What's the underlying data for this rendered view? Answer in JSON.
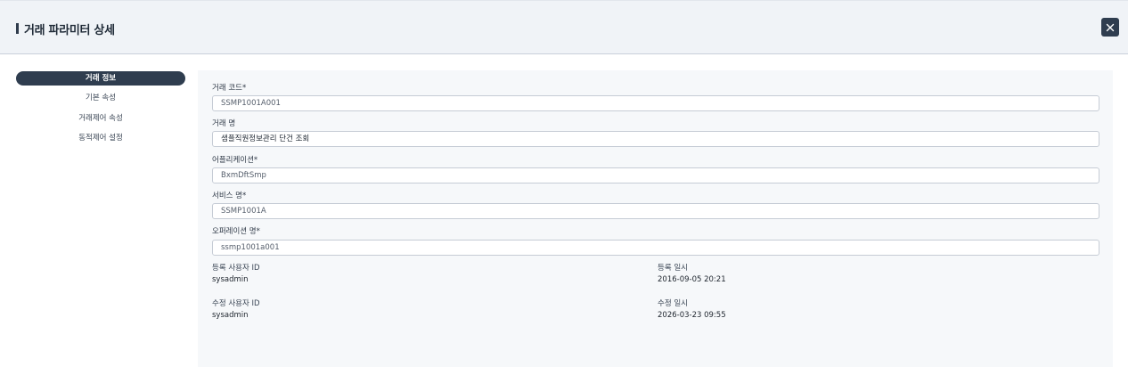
{
  "header": {
    "title": "거래 파라미터 상세",
    "close_icon": "close-icon"
  },
  "sidebar": {
    "items": [
      {
        "label": "거래 정보",
        "active": true
      },
      {
        "label": "기본 속성",
        "active": false
      },
      {
        "label": "거래제어 속성",
        "active": false
      },
      {
        "label": "동적제어 설정",
        "active": false
      }
    ]
  },
  "form": {
    "fields": [
      {
        "label": "거래 코드*",
        "value": "SSMP1001A001"
      },
      {
        "label": "거래 명",
        "value": "샘플직원정보관리 단건 조회"
      },
      {
        "label": "어플리케이션*",
        "value": "BxmDftSmp"
      },
      {
        "label": "서비스 명*",
        "value": "SSMP1001A"
      },
      {
        "label": "오퍼레이션 명*",
        "value": "ssmp1001a001"
      }
    ],
    "meta": {
      "reg_user_label": "등록 사용자 ID",
      "reg_user_value": "sysadmin",
      "reg_date_label": "등록 일시",
      "reg_date_value": "2016-09-05 20:21",
      "mod_user_label": "수정 사용자 ID",
      "mod_user_value": "sysadmin",
      "mod_date_label": "수정 일시",
      "mod_date_value": "2026-03-23 09:55"
    }
  }
}
